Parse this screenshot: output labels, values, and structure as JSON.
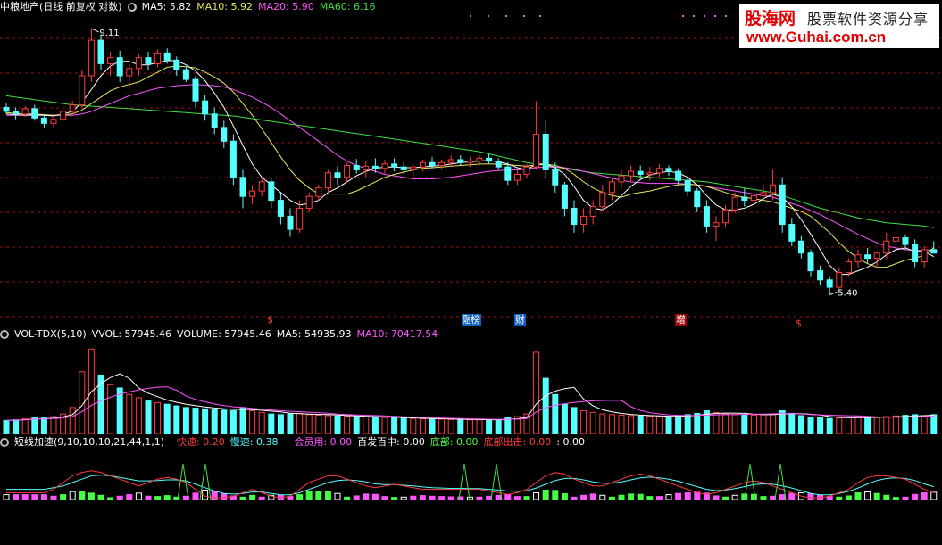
{
  "colors": {
    "up": "#ff3c3c",
    "down": "#54ffff",
    "ma5": "#ffffff",
    "ma10": "#e8e85a",
    "ma20": "#ff55ff",
    "ma60": "#44dd44",
    "grid": "#a01010",
    "volma5": "#ffffff",
    "volma10": "#ff55ff"
  },
  "price_panel": {
    "title": "中粮地产(日线 前复权 对数)",
    "ma5_label": "MA5: 5.82",
    "ma10_label": "MA10: 5.92",
    "ma20_label": "MA20: 5.90",
    "ma60_label": "MA60: 6.16",
    "high_label": "9.11",
    "low_label": "5.40",
    "markers": [
      {
        "text": "$"
      },
      {
        "text": "融"
      },
      {
        "text": "榜"
      },
      {
        "text": "财"
      },
      {
        "text": "增"
      },
      {
        "text": "$"
      }
    ]
  },
  "volume_panel": {
    "title": "VOL-TDX(5,10)",
    "vvol_label": "VVOL: 57945.46",
    "volume_label": "VOLUME: 57945.46",
    "ma5_label": "MA5: 54935.93",
    "ma10_label": "MA10: 70417.54"
  },
  "indicator_panel": {
    "title": "短线加速(9,10,10,10,21,44,1,1)",
    "fast_label": "快速: 0.20",
    "slow_label": "慢速: 0.38",
    "member_label": "会员用: 0.00",
    "hit_label": "百发百中: 0.00",
    "bottom_label": "底部: 0.00",
    "exit_label": "底部出击: 0.00",
    "last_label": ": 0.00"
  },
  "watermark": {
    "brand": "股海网",
    "slogan": "股票软件资源分享",
    "url": "www.Guhai.com.cn"
  },
  "chart_data": {
    "type": "candlestick",
    "title": "中粮地产(日线 前复权 对数)",
    "price_range": [
      5.2,
      9.3
    ],
    "annotations": [
      {
        "text": "9.11",
        "value": 9.11
      },
      {
        "text": "5.40",
        "value": 5.4
      }
    ],
    "ma_last": {
      "MA5": 5.82,
      "MA10": 5.92,
      "MA20": 5.9,
      "MA60": 6.16
    },
    "volume_last": {
      "VOLUME": 57945.46,
      "MA5": 54935.93,
      "MA10": 70417.54
    },
    "candles": [
      [
        7.8,
        7.86,
        7.7,
        7.74
      ],
      [
        7.74,
        7.8,
        7.62,
        7.7
      ],
      [
        7.7,
        7.82,
        7.66,
        7.78
      ],
      [
        7.78,
        7.84,
        7.6,
        7.64
      ],
      [
        7.64,
        7.7,
        7.5,
        7.56
      ],
      [
        7.56,
        7.68,
        7.5,
        7.62
      ],
      [
        7.62,
        7.8,
        7.58,
        7.74
      ],
      [
        7.74,
        7.9,
        7.7,
        7.84
      ],
      [
        7.84,
        8.4,
        7.8,
        8.3
      ],
      [
        8.3,
        9.11,
        8.2,
        8.9
      ],
      [
        8.9,
        9.0,
        8.4,
        8.5
      ],
      [
        8.5,
        8.7,
        8.3,
        8.6
      ],
      [
        8.6,
        8.72,
        8.2,
        8.3
      ],
      [
        8.3,
        8.5,
        8.1,
        8.42
      ],
      [
        8.42,
        8.66,
        8.3,
        8.6
      ],
      [
        8.6,
        8.7,
        8.4,
        8.5
      ],
      [
        8.5,
        8.74,
        8.44,
        8.68
      ],
      [
        8.68,
        8.76,
        8.5,
        8.56
      ],
      [
        8.56,
        8.62,
        8.3,
        8.4
      ],
      [
        8.4,
        8.46,
        8.2,
        8.24
      ],
      [
        8.24,
        8.3,
        7.8,
        7.9
      ],
      [
        7.9,
        8.0,
        7.6,
        7.7
      ],
      [
        7.7,
        7.8,
        7.4,
        7.5
      ],
      [
        7.5,
        7.6,
        7.2,
        7.3
      ],
      [
        7.3,
        7.4,
        6.7,
        6.8
      ],
      [
        6.8,
        6.9,
        6.4,
        6.55
      ],
      [
        6.55,
        6.7,
        6.45,
        6.62
      ],
      [
        6.62,
        6.8,
        6.55,
        6.74
      ],
      [
        6.74,
        6.8,
        6.4,
        6.5
      ],
      [
        6.5,
        6.6,
        6.2,
        6.3
      ],
      [
        6.3,
        6.4,
        6.05,
        6.14
      ],
      [
        6.14,
        6.5,
        6.1,
        6.4
      ],
      [
        6.4,
        6.6,
        6.35,
        6.55
      ],
      [
        6.55,
        6.7,
        6.5,
        6.66
      ],
      [
        6.66,
        6.9,
        6.6,
        6.86
      ],
      [
        6.86,
        6.95,
        6.7,
        6.8
      ],
      [
        6.8,
        7.0,
        6.74,
        6.96
      ],
      [
        6.96,
        7.05,
        6.85,
        6.9
      ],
      [
        6.9,
        7.02,
        6.8,
        6.95
      ],
      [
        6.95,
        7.06,
        6.86,
        6.92
      ],
      [
        6.92,
        7.04,
        6.85,
        6.98
      ],
      [
        6.98,
        7.06,
        6.88,
        6.94
      ],
      [
        6.94,
        7.0,
        6.84,
        6.9
      ],
      [
        6.9,
        6.98,
        6.82,
        6.94
      ],
      [
        6.94,
        7.04,
        6.88,
        7.0
      ],
      [
        7.0,
        7.08,
        6.92,
        6.96
      ],
      [
        6.96,
        7.04,
        6.9,
        7.0
      ],
      [
        7.0,
        7.1,
        6.94,
        7.04
      ],
      [
        7.04,
        7.1,
        6.96,
        7.0
      ],
      [
        7.0,
        7.08,
        6.94,
        7.02
      ],
      [
        7.02,
        7.1,
        6.96,
        7.06
      ],
      [
        7.06,
        7.12,
        6.98,
        7.02
      ],
      [
        7.02,
        7.06,
        6.9,
        6.94
      ],
      [
        6.94,
        7.0,
        6.7,
        6.76
      ],
      [
        6.76,
        6.9,
        6.7,
        6.84
      ],
      [
        6.84,
        6.98,
        6.8,
        6.94
      ],
      [
        6.94,
        7.9,
        6.9,
        7.4
      ],
      [
        7.4,
        7.6,
        6.8,
        6.9
      ],
      [
        6.9,
        7.0,
        6.6,
        6.7
      ],
      [
        6.7,
        6.74,
        6.3,
        6.4
      ],
      [
        6.4,
        6.5,
        6.1,
        6.2
      ],
      [
        6.2,
        6.4,
        6.1,
        6.3
      ],
      [
        6.3,
        6.5,
        6.2,
        6.42
      ],
      [
        6.42,
        6.7,
        6.36,
        6.6
      ],
      [
        6.6,
        6.8,
        6.5,
        6.74
      ],
      [
        6.74,
        6.9,
        6.66,
        6.82
      ],
      [
        6.82,
        6.96,
        6.74,
        6.88
      ],
      [
        6.88,
        6.96,
        6.78,
        6.84
      ],
      [
        6.84,
        6.94,
        6.76,
        6.86
      ],
      [
        6.86,
        6.98,
        6.8,
        6.92
      ],
      [
        6.92,
        6.96,
        6.82,
        6.88
      ],
      [
        6.88,
        6.92,
        6.7,
        6.76
      ],
      [
        6.76,
        6.8,
        6.55,
        6.62
      ],
      [
        6.62,
        6.66,
        6.35,
        6.42
      ],
      [
        6.42,
        6.5,
        6.1,
        6.18
      ],
      [
        6.18,
        6.3,
        6.0,
        6.22
      ],
      [
        6.22,
        6.44,
        6.16,
        6.38
      ],
      [
        6.38,
        6.6,
        6.34,
        6.54
      ],
      [
        6.54,
        6.66,
        6.42,
        6.5
      ],
      [
        6.5,
        6.62,
        6.4,
        6.56
      ],
      [
        6.56,
        6.7,
        6.5,
        6.6
      ],
      [
        6.6,
        6.9,
        6.5,
        6.7
      ],
      [
        6.7,
        6.8,
        6.1,
        6.2
      ],
      [
        6.2,
        6.28,
        5.94,
        6.0
      ],
      [
        6.0,
        6.06,
        5.8,
        5.86
      ],
      [
        5.86,
        5.9,
        5.6,
        5.66
      ],
      [
        5.66,
        5.72,
        5.5,
        5.56
      ],
      [
        5.56,
        5.6,
        5.4,
        5.48
      ],
      [
        5.48,
        5.7,
        5.44,
        5.64
      ],
      [
        5.64,
        5.8,
        5.6,
        5.76
      ],
      [
        5.76,
        5.9,
        5.7,
        5.84
      ],
      [
        5.84,
        5.92,
        5.74,
        5.8
      ],
      [
        5.8,
        5.88,
        5.7,
        5.86
      ],
      [
        5.86,
        6.1,
        5.8,
        6.0
      ],
      [
        6.0,
        6.1,
        5.9,
        6.04
      ],
      [
        6.04,
        6.08,
        5.9,
        5.96
      ],
      [
        5.96,
        6.02,
        5.7,
        5.76
      ],
      [
        5.76,
        5.94,
        5.7,
        5.9
      ],
      [
        5.9,
        6.0,
        5.86,
        5.86
      ]
    ],
    "ma5": [
      7.7,
      7.69,
      7.68,
      7.69,
      7.68,
      7.67,
      7.7,
      7.74,
      7.88,
      8.08,
      8.3,
      8.46,
      8.54,
      8.54,
      8.48,
      8.48,
      8.52,
      8.55,
      8.55,
      8.48,
      8.38,
      8.22,
      8.02,
      7.8,
      7.52,
      7.24,
      6.98,
      6.8,
      6.7,
      6.6,
      6.5,
      6.44,
      6.46,
      6.5,
      6.6,
      6.66,
      6.74,
      6.82,
      6.88,
      6.92,
      6.94,
      6.94,
      6.93,
      6.93,
      6.94,
      6.95,
      6.96,
      6.98,
      7.0,
      7.01,
      7.02,
      7.03,
      7.01,
      6.98,
      6.93,
      6.9,
      6.98,
      6.98,
      6.93,
      6.84,
      6.68,
      6.5,
      6.4,
      6.38,
      6.45,
      6.56,
      6.68,
      6.77,
      6.83,
      6.86,
      6.88,
      6.86,
      6.8,
      6.7,
      6.56,
      6.44,
      6.38,
      6.38,
      6.4,
      6.45,
      6.52,
      6.58,
      6.54,
      6.42,
      6.26,
      6.08,
      5.9,
      5.72,
      5.62,
      5.62,
      5.66,
      5.7,
      5.76,
      5.84,
      5.9,
      5.92,
      5.88,
      5.88,
      5.82
    ],
    "ma10": [
      7.72,
      7.71,
      7.7,
      7.7,
      7.69,
      7.68,
      7.69,
      7.7,
      7.76,
      7.86,
      7.96,
      8.06,
      8.12,
      8.16,
      8.2,
      8.28,
      8.36,
      8.44,
      8.46,
      8.45,
      8.43,
      8.36,
      8.28,
      8.18,
      8.04,
      7.86,
      7.68,
      7.48,
      7.28,
      7.08,
      6.9,
      6.76,
      6.66,
      6.58,
      6.58,
      6.58,
      6.58,
      6.62,
      6.68,
      6.74,
      6.8,
      6.84,
      6.87,
      6.9,
      6.92,
      6.93,
      6.94,
      6.95,
      6.96,
      6.97,
      6.98,
      6.98,
      6.98,
      6.97,
      6.96,
      6.95,
      6.97,
      6.98,
      6.96,
      6.92,
      6.84,
      6.74,
      6.66,
      6.6,
      6.56,
      6.54,
      6.58,
      6.6,
      6.62,
      6.65,
      6.68,
      6.7,
      6.71,
      6.7,
      6.68,
      6.64,
      6.6,
      6.56,
      6.54,
      6.52,
      6.5,
      6.48,
      6.44,
      6.4,
      6.36,
      6.3,
      6.2,
      6.1,
      5.98,
      5.88,
      5.8,
      5.74,
      5.7,
      5.7,
      5.74,
      5.78,
      5.8,
      5.84,
      5.92
    ],
    "ma20": [
      7.68,
      7.68,
      7.68,
      7.68,
      7.68,
      7.68,
      7.68,
      7.68,
      7.7,
      7.74,
      7.8,
      7.86,
      7.92,
      7.98,
      8.02,
      8.06,
      8.1,
      8.12,
      8.14,
      8.15,
      8.16,
      8.15,
      8.14,
      8.12,
      8.08,
      8.02,
      7.96,
      7.88,
      7.8,
      7.7,
      7.6,
      7.5,
      7.4,
      7.3,
      7.2,
      7.1,
      7.02,
      6.96,
      6.92,
      6.88,
      6.84,
      6.82,
      6.8,
      6.78,
      6.78,
      6.78,
      6.79,
      6.8,
      6.82,
      6.84,
      6.86,
      6.88,
      6.89,
      6.9,
      6.9,
      6.91,
      6.93,
      6.94,
      6.94,
      6.93,
      6.91,
      6.88,
      6.85,
      6.82,
      6.79,
      6.76,
      6.74,
      6.73,
      6.72,
      6.72,
      6.72,
      6.72,
      6.71,
      6.7,
      6.68,
      6.66,
      6.64,
      6.62,
      6.6,
      6.58,
      6.56,
      6.54,
      6.5,
      6.46,
      6.42,
      6.37,
      6.32,
      6.26,
      6.2,
      6.14,
      6.08,
      6.03,
      5.98,
      5.94,
      5.92,
      5.9,
      5.89,
      5.89,
      5.9
    ],
    "ma60": [
      7.98,
      7.96,
      7.94,
      7.92,
      7.9,
      7.88,
      7.86,
      7.84,
      7.83,
      7.82,
      7.81,
      7.8,
      7.79,
      7.78,
      7.77,
      7.76,
      7.75,
      7.74,
      7.73,
      7.72,
      7.71,
      7.7,
      7.69,
      7.68,
      7.67,
      7.65,
      7.63,
      7.61,
      7.59,
      7.57,
      7.55,
      7.53,
      7.51,
      7.49,
      7.47,
      7.45,
      7.43,
      7.41,
      7.39,
      7.37,
      7.35,
      7.33,
      7.31,
      7.29,
      7.27,
      7.25,
      7.23,
      7.21,
      7.19,
      7.17,
      7.15,
      7.12,
      7.09,
      7.06,
      7.03,
      7.0,
      6.98,
      6.96,
      6.94,
      6.92,
      6.9,
      6.88,
      6.86,
      6.85,
      6.84,
      6.83,
      6.82,
      6.81,
      6.8,
      6.79,
      6.78,
      6.77,
      6.76,
      6.75,
      6.74,
      6.72,
      6.7,
      6.68,
      6.66,
      6.64,
      6.62,
      6.6,
      6.56,
      6.52,
      6.48,
      6.44,
      6.4,
      6.37,
      6.34,
      6.31,
      6.28,
      6.26,
      6.24,
      6.22,
      6.21,
      6.2,
      6.19,
      6.18,
      6.16
    ],
    "volumes": [
      40000,
      42000,
      45000,
      50000,
      48000,
      52000,
      60000,
      80000,
      190000,
      260000,
      180000,
      150000,
      140000,
      120000,
      110000,
      100000,
      95000,
      90000,
      85000,
      80000,
      78000,
      76000,
      74000,
      72000,
      70000,
      80000,
      70000,
      65000,
      60000,
      58000,
      60000,
      62000,
      58000,
      56000,
      55000,
      54000,
      53000,
      52000,
      51000,
      50000,
      49000,
      48000,
      47000,
      46000,
      45000,
      44000,
      44000,
      43000,
      43000,
      42000,
      42000,
      42000,
      43000,
      48000,
      52000,
      60000,
      250000,
      170000,
      120000,
      90000,
      80000,
      70000,
      65000,
      60000,
      58000,
      56000,
      55000,
      54000,
      53000,
      52000,
      52000,
      54000,
      58000,
      62000,
      70000,
      65000,
      60000,
      58000,
      57000,
      56000,
      58000,
      60000,
      70000,
      62000,
      55000,
      50000,
      48000,
      46000,
      48000,
      50000,
      52000,
      50000,
      49000,
      52000,
      54000,
      56000,
      58000,
      55000,
      57945.46
    ],
    "fast_line": [
      0.2,
      0.2,
      0.2,
      0.2,
      0.2,
      0.3,
      0.5,
      0.7,
      0.8,
      0.85,
      0.8,
      0.7,
      0.6,
      0.5,
      0.4,
      0.5,
      0.6,
      0.65,
      0.6,
      0.5,
      0.3,
      0.1,
      0.05,
      0.05,
      0.1,
      0.2,
      0.3,
      0.2,
      0.1,
      0.05,
      0.1,
      0.3,
      0.5,
      0.6,
      0.7,
      0.7,
      0.6,
      0.5,
      0.4,
      0.35,
      0.4,
      0.45,
      0.4,
      0.35,
      0.3,
      0.3,
      0.3,
      0.3,
      0.3,
      0.3,
      0.3,
      0.25,
      0.2,
      0.15,
      0.2,
      0.3,
      0.5,
      0.7,
      0.8,
      0.75,
      0.6,
      0.5,
      0.4,
      0.4,
      0.5,
      0.6,
      0.7,
      0.75,
      0.7,
      0.6,
      0.5,
      0.4,
      0.3,
      0.2,
      0.15,
      0.2,
      0.3,
      0.4,
      0.5,
      0.55,
      0.5,
      0.4,
      0.3,
      0.2,
      0.1,
      0.05,
      0.05,
      0.1,
      0.2,
      0.3,
      0.5,
      0.65,
      0.7,
      0.7,
      0.65,
      0.6,
      0.45,
      0.3,
      0.2
    ],
    "slow_line": [
      0.3,
      0.3,
      0.3,
      0.3,
      0.3,
      0.35,
      0.4,
      0.5,
      0.6,
      0.7,
      0.72,
      0.7,
      0.65,
      0.6,
      0.55,
      0.55,
      0.56,
      0.58,
      0.58,
      0.55,
      0.45,
      0.35,
      0.25,
      0.18,
      0.16,
      0.18,
      0.22,
      0.22,
      0.18,
      0.14,
      0.14,
      0.2,
      0.3,
      0.4,
      0.5,
      0.56,
      0.58,
      0.56,
      0.52,
      0.46,
      0.44,
      0.44,
      0.42,
      0.4,
      0.37,
      0.35,
      0.34,
      0.33,
      0.33,
      0.32,
      0.32,
      0.3,
      0.28,
      0.25,
      0.24,
      0.26,
      0.34,
      0.45,
      0.56,
      0.62,
      0.62,
      0.58,
      0.52,
      0.48,
      0.48,
      0.52,
      0.58,
      0.64,
      0.66,
      0.64,
      0.6,
      0.54,
      0.46,
      0.38,
      0.3,
      0.26,
      0.28,
      0.32,
      0.38,
      0.44,
      0.46,
      0.45,
      0.4,
      0.34,
      0.26,
      0.18,
      0.14,
      0.14,
      0.18,
      0.24,
      0.34,
      0.46,
      0.56,
      0.62,
      0.64,
      0.62,
      0.56,
      0.46,
      0.38
    ]
  }
}
